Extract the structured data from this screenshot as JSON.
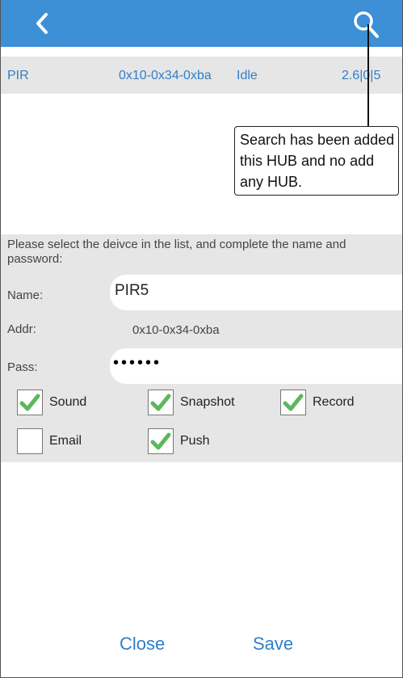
{
  "header": {
    "back_icon": "chevron-left-icon",
    "search_icon": "search-icon",
    "color": "#3d8fd6"
  },
  "device": {
    "type": "PIR",
    "addr": "0x10-0x34-0xba",
    "status": "Idle",
    "version": "2.6|0|5"
  },
  "callout": {
    "text": "Search has been added this HUB and no add any HUB."
  },
  "form": {
    "instructions": "Please select the deivce in the list, and complete the name and password:",
    "name_label": "Name:",
    "name_value": "PIR5",
    "addr_label": "Addr:",
    "addr_value": "0x10-0x34-0xba",
    "pass_label": "Pass:",
    "pass_value": "••••••"
  },
  "options": [
    {
      "label": "Sound",
      "checked": true
    },
    {
      "label": "Snapshot",
      "checked": true
    },
    {
      "label": "Record",
      "checked": true
    },
    {
      "label": "Email",
      "checked": false
    },
    {
      "label": "Push",
      "checked": true
    }
  ],
  "actions": {
    "close": "Close",
    "save": "Save"
  },
  "colors": {
    "accent": "#3d8fd6",
    "panel": "#e6e6e6",
    "check": "#5cb85c"
  }
}
